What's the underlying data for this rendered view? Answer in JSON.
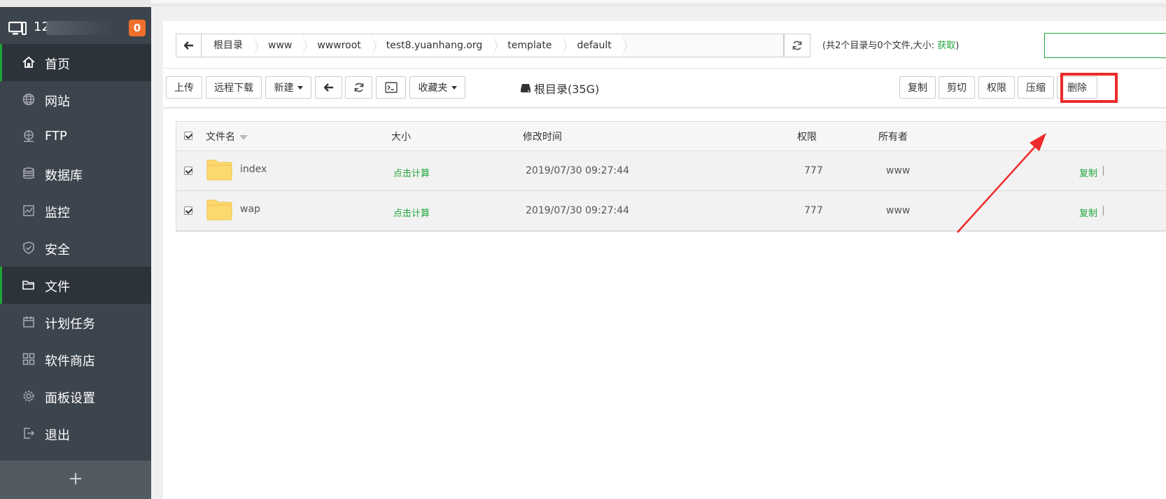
{
  "header": {
    "ip_prefix": "12",
    "badge": "0"
  },
  "nav": [
    {
      "label": "首页",
      "icon": "home-icon",
      "active": true
    },
    {
      "label": "网站",
      "icon": "globe-icon"
    },
    {
      "label": "FTP",
      "icon": "ftp-icon"
    },
    {
      "label": "数据库",
      "icon": "database-icon"
    },
    {
      "label": "监控",
      "icon": "monitor-icon"
    },
    {
      "label": "安全",
      "icon": "shield-icon"
    },
    {
      "label": "文件",
      "icon": "folder-icon",
      "active": true
    },
    {
      "label": "计划任务",
      "icon": "calendar-icon"
    },
    {
      "label": "软件商店",
      "icon": "grid-icon"
    },
    {
      "label": "面板设置",
      "icon": "gear-icon"
    },
    {
      "label": "退出",
      "icon": "logout-icon"
    }
  ],
  "add_label": "+",
  "breadcrumbs": [
    "根目录",
    "www",
    "wwwroot",
    "test8.yuanhang.org",
    "template",
    "default"
  ],
  "summary": {
    "prefix": "(共2个目录与0个文件,大小: ",
    "get": "获取",
    "suffix": ")"
  },
  "toolbar": {
    "upload": "上传",
    "remote_download": "远程下载",
    "new": "新建",
    "favorites": "收藏夹",
    "disk": "根目录(35G)",
    "copy": "复制",
    "cut": "剪切",
    "permission": "权限",
    "compress": "压缩",
    "delete": "删除"
  },
  "table": {
    "headers": {
      "name": "文件名",
      "size": "大小",
      "mtime": "修改时间",
      "perm": "权限",
      "owner": "所有者"
    },
    "rows": [
      {
        "name": "index",
        "size": "点击计算",
        "mtime": "2019/07/30 09:27:44",
        "perm": "777",
        "owner": "www",
        "action": "复制",
        "sep": "|"
      },
      {
        "name": "wap",
        "size": "点击计算",
        "mtime": "2019/07/30 09:27:44",
        "perm": "777",
        "owner": "www",
        "action": "复制",
        "sep": "|"
      }
    ]
  },
  "colors": {
    "accent": "#20a53a",
    "sidebar": "#3c444d",
    "badge": "#f0702b",
    "highlight": "#ee2a2a"
  }
}
